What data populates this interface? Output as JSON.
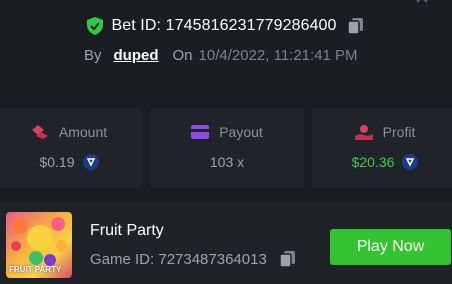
{
  "bet": {
    "id_text": "Bet ID: 1745816231779286400",
    "by_label": "By",
    "username": "duped",
    "on_label": "On",
    "date": "10/4/2022, 11:21:41 PM"
  },
  "stats": {
    "amount": {
      "label": "Amount",
      "value": "$0.19"
    },
    "payout": {
      "label": "Payout",
      "value": "103 x"
    },
    "profit": {
      "label": "Profit",
      "value": "$20.36"
    }
  },
  "game": {
    "title": "Fruit Party",
    "id_text": "Game ID: 7273487364013",
    "thumb_text": "FRUIT PARTY",
    "play_label": "Play Now"
  },
  "colors": {
    "background": "#1a1d21",
    "card": "#20242a",
    "accent_green": "#35c431",
    "profit_green": "#3dcc4a"
  },
  "icons": [
    "close-icon",
    "shield-check-icon",
    "copy-icon",
    "amount-icon",
    "payout-icon",
    "profit-icon",
    "coin-icon"
  ]
}
